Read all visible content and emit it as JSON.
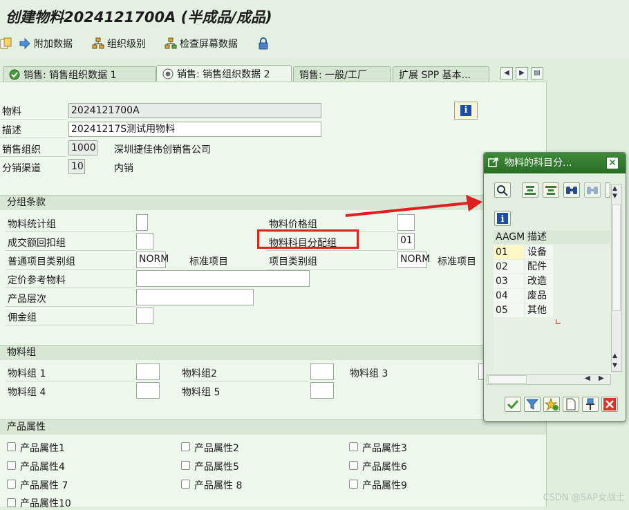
{
  "title": "创建物料2024121700A (半成品/成品)",
  "toolbar": {
    "items": [
      {
        "label": "附加数据",
        "icon": "arrow-right-icon"
      },
      {
        "label": "组织级别",
        "icon": "org-levels-icon"
      },
      {
        "label": "检查屏幕数据",
        "icon": "check-screen-data-icon"
      },
      {
        "label": "",
        "icon": "lock-icon"
      }
    ]
  },
  "tabs": [
    {
      "label": "销售: 销售组织数据 1",
      "icon": "check-icon",
      "active": false
    },
    {
      "label": "销售: 销售组织数据 2",
      "icon": "gear-icon",
      "active": true
    },
    {
      "label": "销售: 一般/工厂",
      "icon": "",
      "active": false
    },
    {
      "label": "扩展 SPP 基本...",
      "icon": "",
      "active": false
    }
  ],
  "header_fields": {
    "material": {
      "label": "物料",
      "value": "2024121700A"
    },
    "description": {
      "label": "描述",
      "value": "20241217S测试用物料"
    },
    "sales_org": {
      "label": "销售组织",
      "value": "1000",
      "text": "深圳捷佳伟创销售公司"
    },
    "dist_channel": {
      "label": "分销渠道",
      "value": "10",
      "text": "内销"
    }
  },
  "grouping": {
    "title": "分组条款",
    "left": [
      {
        "label": "物料统计组",
        "value": ""
      },
      {
        "label": "成交额回扣组",
        "value": ""
      },
      {
        "label": "普通项目类别组",
        "value": "NORM",
        "text": "标准项目"
      },
      {
        "label": "定价参考物料",
        "value": ""
      },
      {
        "label": "产品层次",
        "value": ""
      },
      {
        "label": "佣金组",
        "value": ""
      }
    ],
    "right": [
      {
        "label": "物料价格组",
        "value": ""
      },
      {
        "label": "物料科目分配组",
        "value": "01"
      },
      {
        "label": "项目类别组",
        "value": "NORM",
        "text": "标准项目"
      }
    ]
  },
  "material_groups": {
    "title": "物料组",
    "items": [
      "物料组 1",
      "物料组2",
      "物料组 3",
      "物料组 4",
      "物料组 5"
    ]
  },
  "product_attributes": {
    "title": "产品属性",
    "items": [
      "产品属性1",
      "产品属性2",
      "产品属性3",
      "产品属性4",
      "产品属性5",
      "产品属性6",
      "产品属性 7",
      "产品属性 8",
      "产品属性9",
      "产品属性10"
    ]
  },
  "popup": {
    "title": "物料的科目分...",
    "columns": [
      "AAGM",
      "描述"
    ],
    "rows": [
      {
        "code": "01",
        "desc": "设备"
      },
      {
        "code": "02",
        "desc": "配件"
      },
      {
        "code": "03",
        "desc": "改造"
      },
      {
        "code": "04",
        "desc": "废品"
      },
      {
        "code": "05",
        "desc": "其他"
      }
    ]
  },
  "watermark": "CSDN @SAP女战士",
  "colors": {
    "accent_green": "#2f7a2b",
    "highlight_red": "#e02020",
    "info_blue": "#1c4ea8"
  }
}
